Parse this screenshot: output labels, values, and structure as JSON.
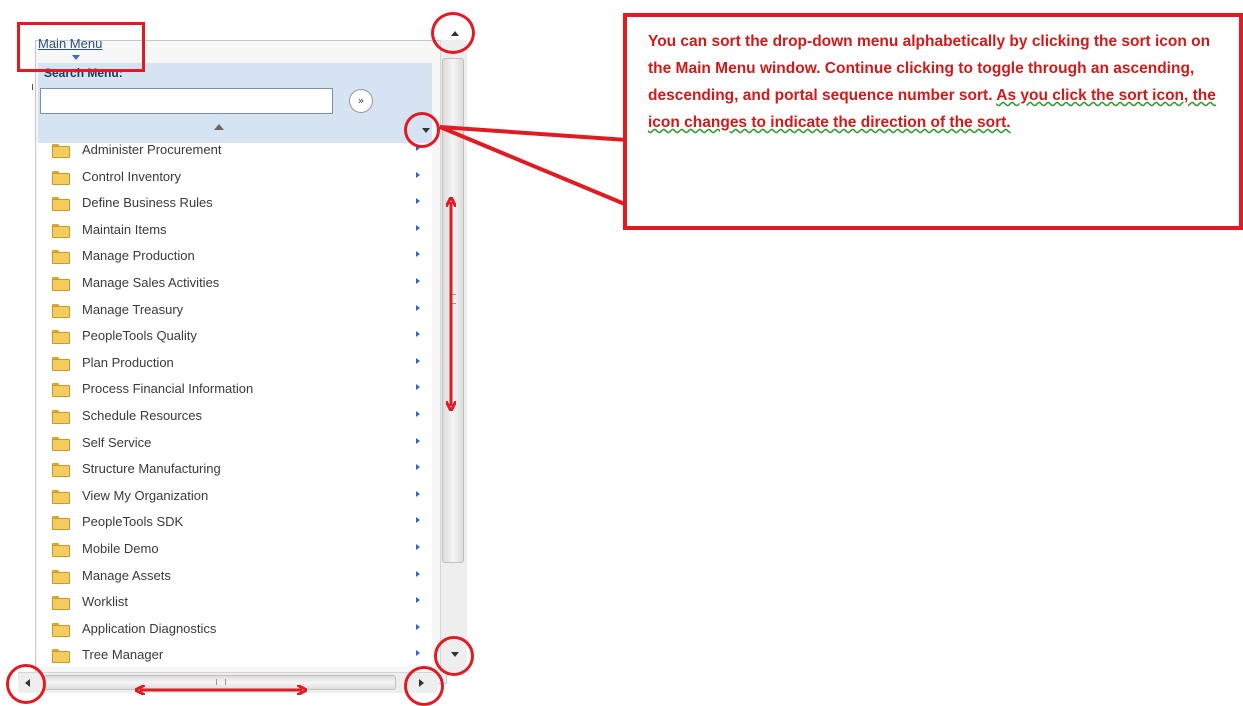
{
  "menu": {
    "title": "Main Menu",
    "search_label": "Search Menu:",
    "search_value": "",
    "search_go_glyph": "»",
    "items": [
      {
        "label": "Administer Procurement",
        "icon": "folder-icon"
      },
      {
        "label": "Control Inventory",
        "icon": "folder-icon"
      },
      {
        "label": "Define Business Rules",
        "icon": "folder-icon"
      },
      {
        "label": "Maintain Items",
        "icon": "folder-icon"
      },
      {
        "label": "Manage Production",
        "icon": "folder-icon"
      },
      {
        "label": "Manage Sales Activities",
        "icon": "folder-icon"
      },
      {
        "label": "Manage Treasury",
        "icon": "folder-icon"
      },
      {
        "label": "PeopleTools Quality",
        "icon": "folder-icon"
      },
      {
        "label": "Plan Production",
        "icon": "folder-icon"
      },
      {
        "label": "Process Financial Information",
        "icon": "folder-icon"
      },
      {
        "label": "Schedule Resources",
        "icon": "folder-icon"
      },
      {
        "label": "Self Service",
        "icon": "folder-icon"
      },
      {
        "label": "Structure Manufacturing",
        "icon": "folder-icon"
      },
      {
        "label": "View My Organization",
        "icon": "folder-icon"
      },
      {
        "label": "PeopleTools SDK",
        "icon": "folder-icon"
      },
      {
        "label": "Mobile Demo",
        "icon": "folder-icon"
      },
      {
        "label": "Manage Assets",
        "icon": "folder-icon"
      },
      {
        "label": "Worklist",
        "icon": "folder-icon"
      },
      {
        "label": "Application Diagnostics",
        "icon": "folder-icon"
      },
      {
        "label": "Tree Manager",
        "icon": "folder-icon"
      }
    ]
  },
  "callout": {
    "text_plain": "You can sort the drop-down menu alphabetically by clicking the sort icon on the Main Menu window. Continue clicking to toggle through an ascending, descending, and portal sequence number sort. ",
    "text_underlined": "As you click the sort icon, the icon changes to indicate the direction of the sort."
  },
  "colors": {
    "annotation_red": "#e11b22",
    "search_panel_bg": "#d6e3f2",
    "menu_title": "#2c4f84",
    "submenu_arrow": "#2f67c4",
    "folder_yellow": "#f4cc5e"
  }
}
